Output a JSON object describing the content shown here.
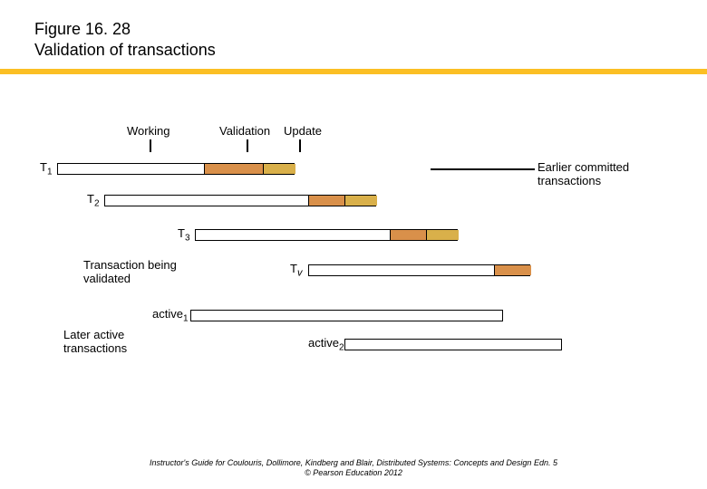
{
  "figure": {
    "number": "Figure 16. 28",
    "title": "Validation of transactions"
  },
  "phases": {
    "working": "Working",
    "validation": "Validation",
    "update": "Update"
  },
  "transactions": {
    "t1": "T",
    "t1_sub": "1",
    "t2": "T",
    "t2_sub": "2",
    "t3": "T",
    "t3_sub": "3",
    "tv": "T",
    "tv_sub": "v",
    "active1": "active",
    "active1_sub": "1",
    "active2": "active",
    "active2_sub": "2"
  },
  "annotations": {
    "earlier": "Earlier committed transactions",
    "being_validated": "Transaction being validated",
    "later": "Later active transactions"
  },
  "chart_data": {
    "type": "gantt-diagram",
    "phases": [
      "Working",
      "Validation",
      "Update"
    ],
    "rows": [
      {
        "id": "T1",
        "group": "earlier_committed",
        "segments": [
          {
            "phase": "Working",
            "start": 63,
            "end": 225
          },
          {
            "phase": "Validation",
            "start": 225,
            "end": 290
          },
          {
            "phase": "Update",
            "start": 290,
            "end": 325
          }
        ]
      },
      {
        "id": "T2",
        "group": "earlier_committed",
        "segments": [
          {
            "phase": "Working",
            "start": 115,
            "end": 340
          },
          {
            "phase": "Validation",
            "start": 340,
            "end": 380
          },
          {
            "phase": "Update",
            "start": 380,
            "end": 415
          }
        ]
      },
      {
        "id": "T3",
        "group": "earlier_committed",
        "segments": [
          {
            "phase": "Working",
            "start": 215,
            "end": 430
          },
          {
            "phase": "Validation",
            "start": 430,
            "end": 470
          },
          {
            "phase": "Update",
            "start": 470,
            "end": 505
          }
        ]
      },
      {
        "id": "Tv",
        "group": "being_validated",
        "segments": [
          {
            "phase": "Working",
            "start": 340,
            "end": 545
          },
          {
            "phase": "Validation",
            "start": 545,
            "end": 585
          }
        ]
      },
      {
        "id": "active1",
        "group": "later_active",
        "segments": [
          {
            "phase": "Working",
            "start": 210,
            "end": 555
          }
        ]
      },
      {
        "id": "active2",
        "group": "later_active",
        "segments": [
          {
            "phase": "Working",
            "start": 380,
            "end": 620
          }
        ]
      }
    ],
    "annotations": [
      {
        "text": "Earlier committed transactions",
        "applies_to": [
          "T1",
          "T2",
          "T3"
        ]
      },
      {
        "text": "Transaction being validated",
        "applies_to": [
          "Tv"
        ]
      },
      {
        "text": "Later active transactions",
        "applies_to": [
          "active1",
          "active2"
        ]
      }
    ]
  },
  "footer": {
    "line1": "Instructor's Guide for  Coulouris, Dollimore, Kindberg and Blair,  Distributed Systems: Concepts and Design   Edn. 5",
    "line2": "©  Pearson Education 2012"
  }
}
